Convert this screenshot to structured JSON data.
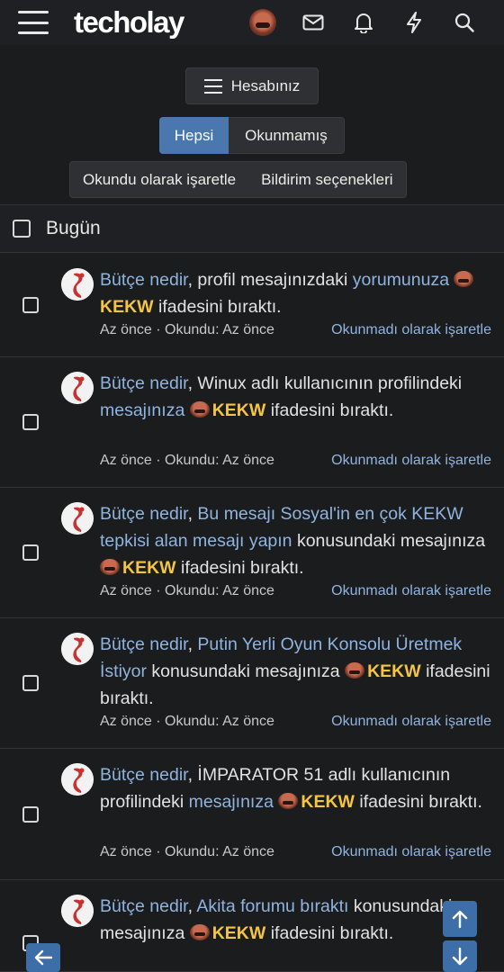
{
  "header": {
    "logo": "techolay",
    "icons": [
      "menu-icon",
      "avatar",
      "mail-icon",
      "bell-icon",
      "lightning-icon",
      "search-icon"
    ]
  },
  "account": {
    "button_label": "Hesabınız",
    "tabs": [
      {
        "label": "Hepsi",
        "active": true
      },
      {
        "label": "Okunmamış",
        "active": false
      }
    ],
    "actions": [
      "Okundu olarak işaretle",
      "Bildirim seçenekleri"
    ]
  },
  "day_header": "Bugün",
  "alerts": [
    {
      "user": "Bütçe nedir",
      "parts": [
        ", profil mesajınızdaki ",
        "yorumunuza"
      ],
      "emoji_label": "KEKW",
      "tail": "ifadesini bıraktı.",
      "meta": "Az önce · Okundu: Az önce",
      "action": "Okunmadı olarak işaretle"
    },
    {
      "user": "Bütçe nedir",
      "parts": [
        ", Winux adlı kullanıcının profilindeki ",
        "mesajınıza"
      ],
      "emoji_label": "KEKW",
      "tail": "ifadesini bıraktı.",
      "meta": "Az önce · Okundu: Az önce",
      "action": "Okunmadı olarak işaretle"
    },
    {
      "user": "Bütçe nedir",
      "thread": "Bu mesajı Sosyal'in en çok KEKW tepkisi alan mesajı yapın",
      "parts": [
        " konusundaki mesajınıza "
      ],
      "emoji_label": "KEKW",
      "tail": "ifadesini bıraktı.",
      "meta": "Az önce · Okundu: Az önce",
      "action": "Okunmadı olarak işaretle"
    },
    {
      "user": "Bütçe nedir",
      "thread": "Putin Yerli Oyun Konsolu Üretmek İstiyor",
      "parts": [
        " konusundaki mesajınıza "
      ],
      "emoji_label": "KEKW",
      "tail": "ifadesini bıraktı.",
      "meta": "Az önce · Okundu: Az önce",
      "action": "Okunmadı olarak işaretle"
    },
    {
      "user": "Bütçe nedir",
      "parts": [
        ", İMPARATOR 51 adlı kullanıcının profilindeki ",
        "mesajınıza"
      ],
      "emoji_label": "KEKW",
      "tail": "ifadesini bıraktı.",
      "meta": "Az önce · Okundu: Az önce",
      "action": "Okunmadı olarak işaretle"
    },
    {
      "user": "Bütçe nedir",
      "thread": "Akita forumu bıraktı",
      "parts": [
        " konusundaki mesajınıza "
      ],
      "emoji_label": "KEKW",
      "tail": "ifadesini bıraktı."
    }
  ],
  "colors": {
    "background": "#1b1c1e",
    "link": "#8fb4e0",
    "accent": "#4a77ad",
    "kekw": "#f5c542"
  },
  "float_buttons": [
    "arrow-up-icon",
    "arrow-down-icon",
    "arrow-left-icon"
  ]
}
